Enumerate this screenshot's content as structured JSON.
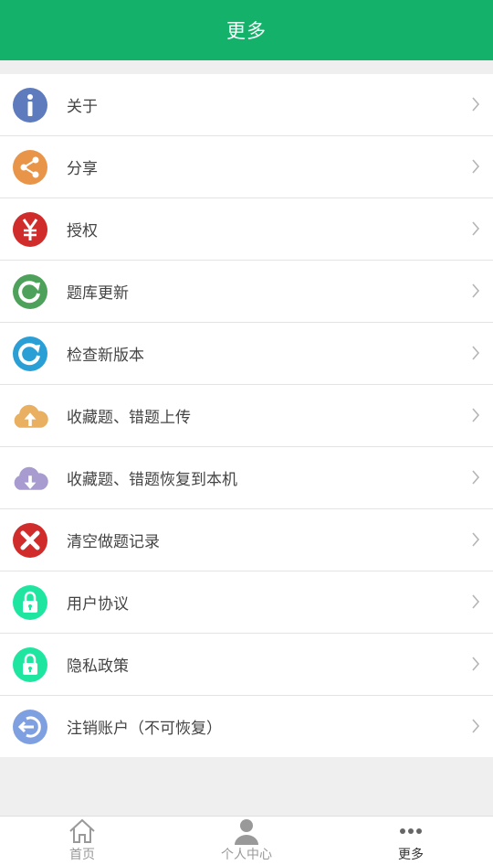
{
  "header": {
    "title": "更多"
  },
  "menu": [
    {
      "label": "关于",
      "icon": "info-icon",
      "color": "#5d7bbd"
    },
    {
      "label": "分享",
      "icon": "share-icon",
      "color": "#e8954a"
    },
    {
      "label": "授权",
      "icon": "yen-icon",
      "color": "#d02c2c"
    },
    {
      "label": "题库更新",
      "icon": "refresh-icon",
      "color": "#4ea15a"
    },
    {
      "label": "检查新版本",
      "icon": "refresh-icon",
      "color": "#2a9fd6"
    },
    {
      "label": "收藏题、错题上传",
      "icon": "cloud-upload-icon",
      "color": "#e8b060"
    },
    {
      "label": "收藏题、错题恢复到本机",
      "icon": "cloud-download-icon",
      "color": "#a89bd0"
    },
    {
      "label": "清空做题记录",
      "icon": "close-icon",
      "color": "#d02c2c"
    },
    {
      "label": "用户协议",
      "icon": "lock-icon",
      "color": "#1ee6a0"
    },
    {
      "label": "隐私政策",
      "icon": "lock-icon",
      "color": "#1ee6a0"
    },
    {
      "label": "注销账户（不可恢复）",
      "icon": "logout-icon",
      "color": "#7fa0e0"
    }
  ],
  "tabs": [
    {
      "label": "首页",
      "icon": "home-icon"
    },
    {
      "label": "个人中心",
      "icon": "user-icon"
    },
    {
      "label": "更多",
      "icon": "more-icon"
    }
  ]
}
